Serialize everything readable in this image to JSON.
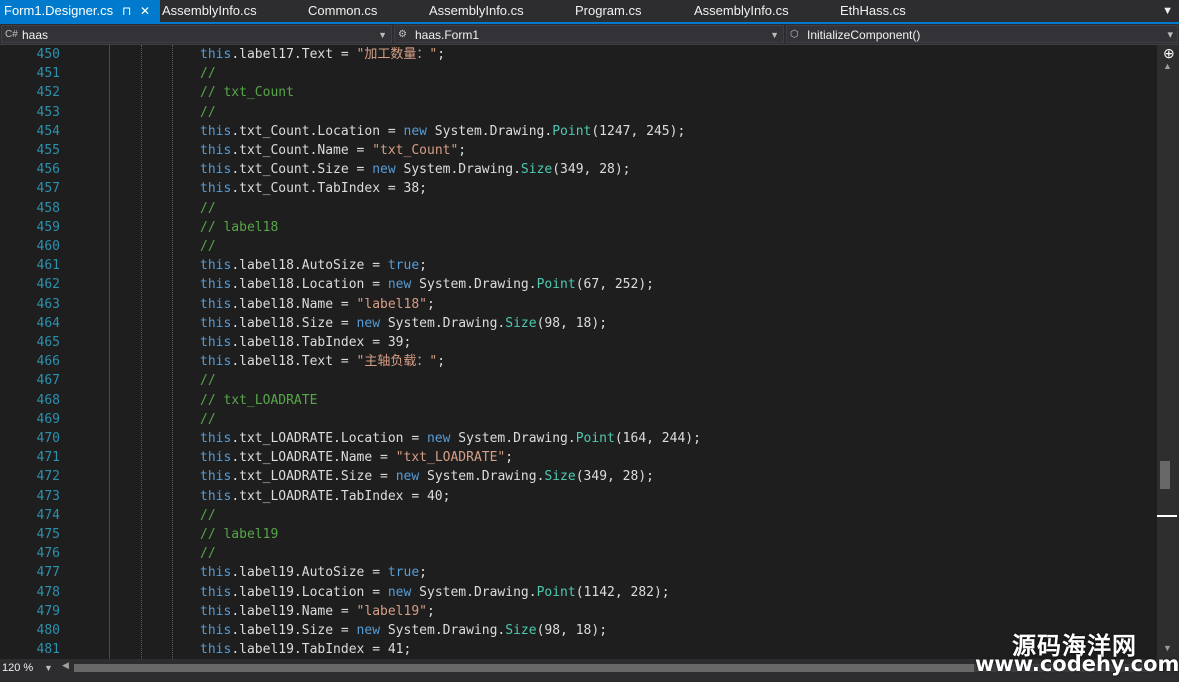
{
  "tabs": [
    {
      "label": "Form1.Designer.cs",
      "active": true
    },
    {
      "label": "AssemblyInfo.cs",
      "active": false
    },
    {
      "label": "Common.cs",
      "active": false
    },
    {
      "label": "AssemblyInfo.cs",
      "active": false
    },
    {
      "label": "Program.cs",
      "active": false
    },
    {
      "label": "AssemblyInfo.cs",
      "active": false
    },
    {
      "label": "EthHass.cs",
      "active": false
    }
  ],
  "tab_pin_glyph": "⊓",
  "tab_close_glyph": "✕",
  "nav": {
    "project": "haas",
    "class": "haas.Form1",
    "member": "InitializeComponent()"
  },
  "zoom": "120 %",
  "watermark": {
    "line1": "源码海洋网",
    "line2": "www.codehy.com"
  },
  "colors": {
    "accent": "#007acc",
    "keyword": "#569cd6",
    "string": "#d69d85",
    "comment": "#57a64a",
    "type": "#4ec9b0",
    "line_number": "#2b91af"
  },
  "code": [
    {
      "n": "450",
      "tokens": [
        [
          "kw",
          "this"
        ],
        [
          "p",
          ".label17.Text = "
        ],
        [
          "str",
          "\"加工数量：\""
        ],
        [
          "p",
          ";"
        ]
      ]
    },
    {
      "n": "451",
      "tokens": [
        [
          "cm",
          "//"
        ]
      ]
    },
    {
      "n": "452",
      "tokens": [
        [
          "cm",
          "// txt_Count"
        ]
      ]
    },
    {
      "n": "453",
      "tokens": [
        [
          "cm",
          "//"
        ]
      ]
    },
    {
      "n": "454",
      "tokens": [
        [
          "kw",
          "this"
        ],
        [
          "p",
          ".txt_Count.Location = "
        ],
        [
          "kw",
          "new"
        ],
        [
          "p",
          " System.Drawing."
        ],
        [
          "ty",
          "Point"
        ],
        [
          "p",
          "(1247, 245);"
        ]
      ]
    },
    {
      "n": "455",
      "tokens": [
        [
          "kw",
          "this"
        ],
        [
          "p",
          ".txt_Count.Name = "
        ],
        [
          "str",
          "\"txt_Count\""
        ],
        [
          "p",
          ";"
        ]
      ]
    },
    {
      "n": "456",
      "tokens": [
        [
          "kw",
          "this"
        ],
        [
          "p",
          ".txt_Count.Size = "
        ],
        [
          "kw",
          "new"
        ],
        [
          "p",
          " System.Drawing."
        ],
        [
          "ty",
          "Size"
        ],
        [
          "p",
          "(349, 28);"
        ]
      ]
    },
    {
      "n": "457",
      "tokens": [
        [
          "kw",
          "this"
        ],
        [
          "p",
          ".txt_Count.TabIndex = 38;"
        ]
      ]
    },
    {
      "n": "458",
      "tokens": [
        [
          "cm",
          "//"
        ]
      ]
    },
    {
      "n": "459",
      "tokens": [
        [
          "cm",
          "// label18"
        ]
      ]
    },
    {
      "n": "460",
      "tokens": [
        [
          "cm",
          "//"
        ]
      ]
    },
    {
      "n": "461",
      "tokens": [
        [
          "kw",
          "this"
        ],
        [
          "p",
          ".label18.AutoSize = "
        ],
        [
          "kw",
          "true"
        ],
        [
          "p",
          ";"
        ]
      ]
    },
    {
      "n": "462",
      "tokens": [
        [
          "kw",
          "this"
        ],
        [
          "p",
          ".label18.Location = "
        ],
        [
          "kw",
          "new"
        ],
        [
          "p",
          " System.Drawing."
        ],
        [
          "ty",
          "Point"
        ],
        [
          "p",
          "(67, 252);"
        ]
      ]
    },
    {
      "n": "463",
      "tokens": [
        [
          "kw",
          "this"
        ],
        [
          "p",
          ".label18.Name = "
        ],
        [
          "str",
          "\"label18\""
        ],
        [
          "p",
          ";"
        ]
      ]
    },
    {
      "n": "464",
      "tokens": [
        [
          "kw",
          "this"
        ],
        [
          "p",
          ".label18.Size = "
        ],
        [
          "kw",
          "new"
        ],
        [
          "p",
          " System.Drawing."
        ],
        [
          "ty",
          "Size"
        ],
        [
          "p",
          "(98, 18);"
        ]
      ]
    },
    {
      "n": "465",
      "tokens": [
        [
          "kw",
          "this"
        ],
        [
          "p",
          ".label18.TabIndex = 39;"
        ]
      ]
    },
    {
      "n": "466",
      "tokens": [
        [
          "kw",
          "this"
        ],
        [
          "p",
          ".label18.Text = "
        ],
        [
          "str",
          "\"主轴负载：\""
        ],
        [
          "p",
          ";"
        ]
      ]
    },
    {
      "n": "467",
      "tokens": [
        [
          "cm",
          "//"
        ]
      ]
    },
    {
      "n": "468",
      "tokens": [
        [
          "cm",
          "// txt_LOADRATE"
        ]
      ]
    },
    {
      "n": "469",
      "tokens": [
        [
          "cm",
          "//"
        ]
      ]
    },
    {
      "n": "470",
      "tokens": [
        [
          "kw",
          "this"
        ],
        [
          "p",
          ".txt_LOADRATE.Location = "
        ],
        [
          "kw",
          "new"
        ],
        [
          "p",
          " System.Drawing."
        ],
        [
          "ty",
          "Point"
        ],
        [
          "p",
          "(164, 244);"
        ]
      ]
    },
    {
      "n": "471",
      "tokens": [
        [
          "kw",
          "this"
        ],
        [
          "p",
          ".txt_LOADRATE.Name = "
        ],
        [
          "str",
          "\"txt_LOADRATE\""
        ],
        [
          "p",
          ";"
        ]
      ]
    },
    {
      "n": "472",
      "tokens": [
        [
          "kw",
          "this"
        ],
        [
          "p",
          ".txt_LOADRATE.Size = "
        ],
        [
          "kw",
          "new"
        ],
        [
          "p",
          " System.Drawing."
        ],
        [
          "ty",
          "Size"
        ],
        [
          "p",
          "(349, 28);"
        ]
      ]
    },
    {
      "n": "473",
      "tokens": [
        [
          "kw",
          "this"
        ],
        [
          "p",
          ".txt_LOADRATE.TabIndex = 40;"
        ]
      ]
    },
    {
      "n": "474",
      "tokens": [
        [
          "cm",
          "//"
        ]
      ]
    },
    {
      "n": "475",
      "tokens": [
        [
          "cm",
          "// label19"
        ]
      ]
    },
    {
      "n": "476",
      "tokens": [
        [
          "cm",
          "//"
        ]
      ]
    },
    {
      "n": "477",
      "tokens": [
        [
          "kw",
          "this"
        ],
        [
          "p",
          ".label19.AutoSize = "
        ],
        [
          "kw",
          "true"
        ],
        [
          "p",
          ";"
        ]
      ]
    },
    {
      "n": "478",
      "tokens": [
        [
          "kw",
          "this"
        ],
        [
          "p",
          ".label19.Location = "
        ],
        [
          "kw",
          "new"
        ],
        [
          "p",
          " System.Drawing."
        ],
        [
          "ty",
          "Point"
        ],
        [
          "p",
          "(1142, 282);"
        ]
      ]
    },
    {
      "n": "479",
      "tokens": [
        [
          "kw",
          "this"
        ],
        [
          "p",
          ".label19.Name = "
        ],
        [
          "str",
          "\"label19\""
        ],
        [
          "p",
          ";"
        ]
      ]
    },
    {
      "n": "480",
      "tokens": [
        [
          "kw",
          "this"
        ],
        [
          "p",
          ".label19.Size = "
        ],
        [
          "kw",
          "new"
        ],
        [
          "p",
          " System.Drawing."
        ],
        [
          "ty",
          "Size"
        ],
        [
          "p",
          "(98, 18);"
        ]
      ]
    },
    {
      "n": "481",
      "tokens": [
        [
          "kw",
          "this"
        ],
        [
          "p",
          ".label19.TabIndex = 41;"
        ]
      ]
    }
  ]
}
